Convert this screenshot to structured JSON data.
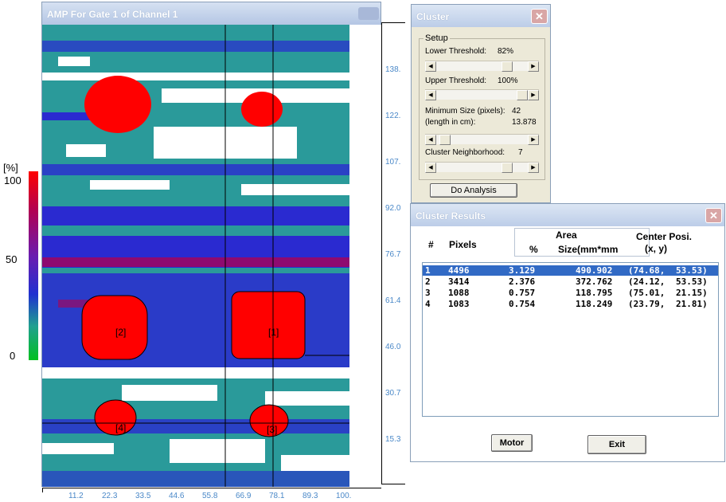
{
  "amp_window": {
    "title": "AMP For Gate 1 of Channel 1"
  },
  "legend": {
    "unit": "[%]",
    "max": "100",
    "mid": "50",
    "min": "0"
  },
  "right_axis": {
    "ticks": [
      "138.",
      "122.",
      "107.",
      "92.0",
      "76.7",
      "61.4",
      "46.0",
      "30.7",
      "15.3"
    ]
  },
  "bottom_axis": {
    "ticks": [
      "11.2",
      "22.3",
      "33.5",
      "44.6",
      "55.8",
      "66.9",
      "78.1",
      "89.3",
      "100."
    ]
  },
  "map_labels": [
    "[2]",
    "[1]",
    "[4]",
    "[3]"
  ],
  "colors": {
    "hot": "#ff0000",
    "high": "#b00050",
    "mid": "#2a2ad0",
    "low": "#2a9a9a",
    "none": "#ffffff",
    "selection": "#316ac5"
  },
  "cluster_window": {
    "title": "Cluster",
    "close_icon": "close-icon",
    "setup_group": "Setup",
    "lower_threshold": {
      "label": "Lower Threshold:",
      "value": "82%"
    },
    "upper_threshold": {
      "label": "Upper Threshold:",
      "value": "100%"
    },
    "min_size": {
      "label": "Minimum Size (pixels):",
      "value": "42"
    },
    "length": {
      "label": "(length in cm):",
      "value": "13.878"
    },
    "neighborhood": {
      "label": "Cluster Neighborhood:",
      "value": "7"
    },
    "do_analysis": "Do Analysis"
  },
  "results_window": {
    "title": "Cluster Results",
    "close_icon": "close-icon",
    "headers": {
      "num": "#",
      "pixels": "Pixels",
      "area": "Area",
      "pct": "%",
      "size": "Size(mm*mm",
      "center": "Center Posi.",
      "xy": "(x, y)"
    },
    "rows": [
      {
        "num": "1",
        "pixels": "4496",
        "pct": "3.129",
        "size": "490.902",
        "x": "(74.68,",
        "y": "53.53)",
        "selected": true
      },
      {
        "num": "2",
        "pixels": "3414",
        "pct": "2.376",
        "size": "372.762",
        "x": "(24.12,",
        "y": "53.53)",
        "selected": false
      },
      {
        "num": "3",
        "pixels": "1088",
        "pct": "0.757",
        "size": "118.795",
        "x": "(75.01,",
        "y": "21.15)",
        "selected": false
      },
      {
        "num": "4",
        "pixels": "1083",
        "pct": "0.754",
        "size": "118.249",
        "x": "(23.79,",
        "y": "21.81)",
        "selected": false
      }
    ],
    "motor_button": "Motor",
    "exit_button": "Exit"
  }
}
